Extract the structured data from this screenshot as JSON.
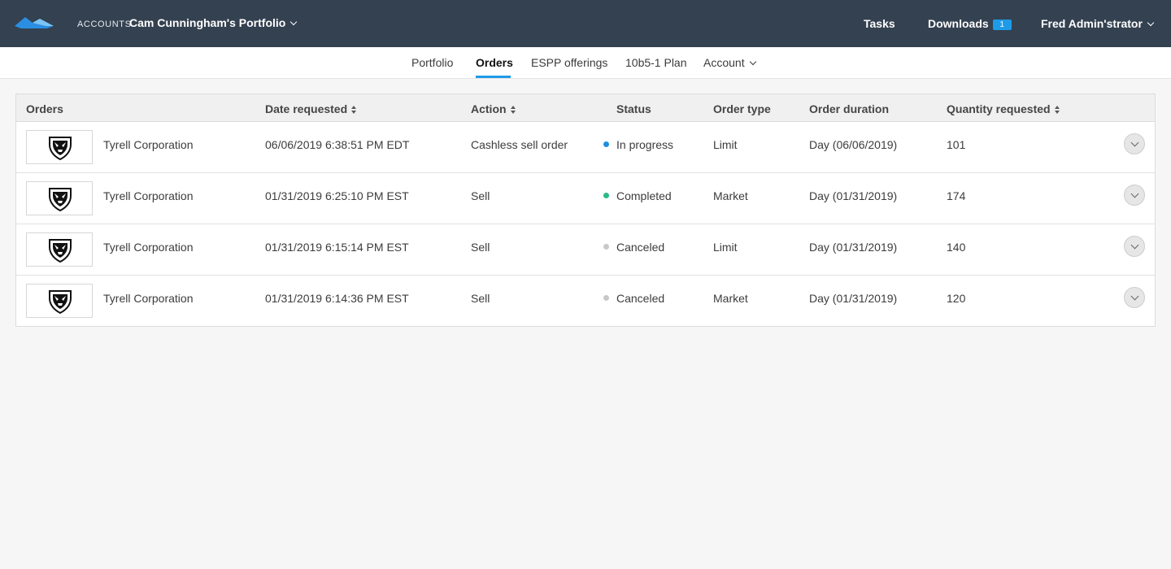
{
  "header": {
    "accounts_label": "ACCOUNTS",
    "portfolio_name": "Cam Cunningham's Portfolio",
    "tasks_label": "Tasks",
    "downloads_label": "Downloads",
    "downloads_count": "1",
    "user_name": "Fred Admin'strator",
    "brand_color": "#344150",
    "accent_color": "#1e9be8"
  },
  "nav": {
    "portfolio": "Portfolio",
    "orders": "Orders",
    "espp": "ESPP offerings",
    "plan": "10b5-1 Plan",
    "account": "Account",
    "active": "Orders"
  },
  "table": {
    "columns": {
      "orders": "Orders",
      "date": "Date requested",
      "action": "Action",
      "status": "Status",
      "order_type": "Order type",
      "duration": "Order duration",
      "quantity": "Quantity requested"
    },
    "rows": [
      {
        "company": "Tyrell Corporation",
        "date": "06/06/2019 6:38:51 PM EDT",
        "action": "Cashless sell order",
        "status": "In progress",
        "status_color": "#1e8fe0",
        "order_type": "Limit",
        "duration": "Day (06/06/2019)",
        "quantity": "101"
      },
      {
        "company": "Tyrell Corporation",
        "date": "01/31/2019 6:25:10 PM EST",
        "action": "Sell",
        "status": "Completed",
        "status_color": "#2eb886",
        "order_type": "Market",
        "duration": "Day (01/31/2019)",
        "quantity": "174"
      },
      {
        "company": "Tyrell Corporation",
        "date": "01/31/2019 6:15:14 PM EST",
        "action": "Sell",
        "status": "Canceled",
        "status_color": "#c8c8c8",
        "order_type": "Limit",
        "duration": "Day (01/31/2019)",
        "quantity": "140"
      },
      {
        "company": "Tyrell Corporation",
        "date": "01/31/2019 6:14:36 PM EST",
        "action": "Sell",
        "status": "Canceled",
        "status_color": "#c8c8c8",
        "order_type": "Market",
        "duration": "Day (01/31/2019)",
        "quantity": "120"
      }
    ]
  }
}
